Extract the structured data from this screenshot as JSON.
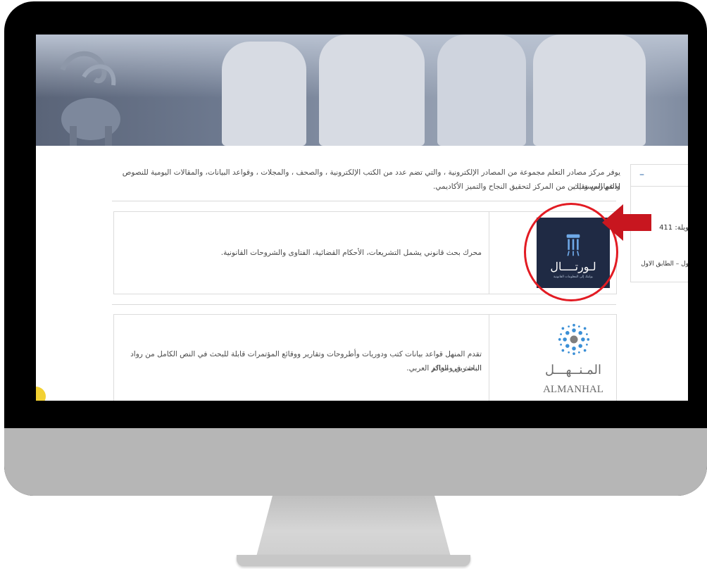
{
  "intro": {
    "line1": "يوفر مركز مصادر التعلم مجموعة من المصادر الإلكترونية ، والتي تضم عدد من الكتب الإلكترونية ، والصحف ، والمجلات ، وقواعد البيانات، والمقالات اليومية للنصوص والفهارس وذلك",
    "line2": "لدعم المستفيدين من المركز لتحقيق النجاح والتميز الأكاديمي."
  },
  "resources": [
    {
      "name": "portal",
      "logo_text": "لـورتــــال",
      "logo_subtext": "بوابتك إلى المعلومات القانونية",
      "description": "محرك بحث قانوني يشمل التشريعات، الأحكام القضائية، الفتاوى والشروحات القانونية."
    },
    {
      "name": "almanhal",
      "logo_arabic": "المـنــهـــل",
      "logo_latin": "ALMANHAL",
      "description_line1": "تقدم المنهل قواعد بيانات كتب ودوريات وأطروحات وتقارير ووقائع المؤتمرات قابلة للبحث في النص الكامل من رواد الناشرين ومراكز",
      "description_line2": "البحث في العالم العربي."
    }
  ],
  "sidebar": {
    "toggle": "–",
    "label": "ويلة: 411",
    "sub": "ول – الطابق الأول"
  },
  "colors": {
    "accent_red": "#e21b23",
    "portal_bg": "#1f2a44",
    "almanhal_blue": "#2d6aa8",
    "marker_yellow": "#f2d133"
  }
}
